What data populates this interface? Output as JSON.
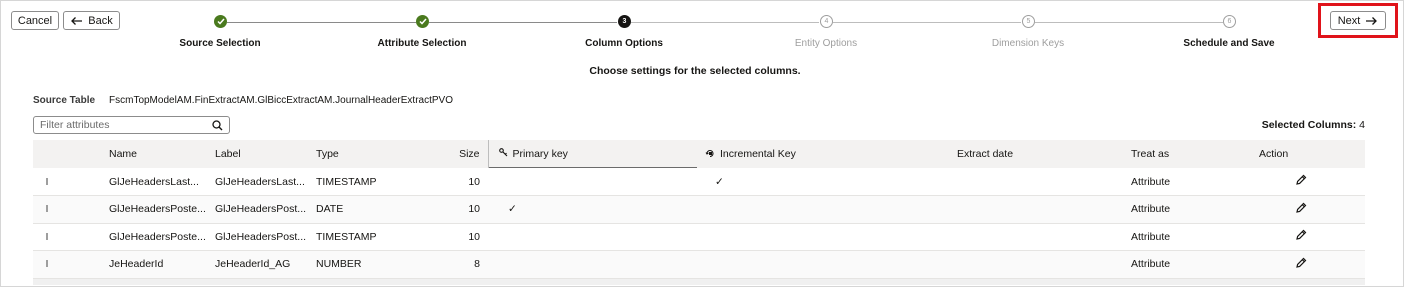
{
  "toolbar": {
    "cancel_label": "Cancel",
    "back_label": "Back",
    "next_label": "Next"
  },
  "train": {
    "steps": [
      {
        "number": "1",
        "label": "Source Selection",
        "state": "done"
      },
      {
        "number": "2",
        "label": "Attribute Selection",
        "state": "done"
      },
      {
        "number": "3",
        "label": "Column Options",
        "state": "current"
      },
      {
        "number": "4",
        "label": "Entity Options",
        "state": "future"
      },
      {
        "number": "5",
        "label": "Dimension Keys",
        "state": "future"
      },
      {
        "number": "6",
        "label": "Schedule and Save",
        "state": "future"
      }
    ]
  },
  "page": {
    "subtitle": "Choose settings for the selected columns.",
    "source_table_label": "Source Table",
    "source_table_value": "FscmTopModelAM.FinExtractAM.GlBiccExtractAM.JournalHeaderExtractPVO"
  },
  "filter": {
    "placeholder": "Filter attributes"
  },
  "selected": {
    "label": "Selected Columns:",
    "count": "4"
  },
  "table": {
    "headers": {
      "name": "Name",
      "label": "Label",
      "type": "Type",
      "size": "Size",
      "primary_key": "Primary key",
      "incremental_key": "Incremental Key",
      "extract_date": "Extract date",
      "treat_as": "Treat as",
      "action": "Action"
    },
    "rows": [
      {
        "name": "GlJeHeadersLast...",
        "label": "GlJeHeadersLast...",
        "type": "TIMESTAMP",
        "size": "10",
        "primary_key": "",
        "incremental_key": "✓",
        "extract_date": "",
        "treat_as": "Attribute"
      },
      {
        "name": "GlJeHeadersPoste...",
        "label": "GlJeHeadersPost...",
        "type": "DATE",
        "size": "10",
        "primary_key": "✓",
        "incremental_key": "",
        "extract_date": "",
        "treat_as": "Attribute"
      },
      {
        "name": "GlJeHeadersPoste...",
        "label": "GlJeHeadersPost...",
        "type": "TIMESTAMP",
        "size": "10",
        "primary_key": "",
        "incremental_key": "",
        "extract_date": "",
        "treat_as": "Attribute"
      },
      {
        "name": "JeHeaderId",
        "label": "JeHeaderId_AG",
        "type": "NUMBER",
        "size": "8",
        "primary_key": "",
        "incremental_key": "",
        "extract_date": "",
        "treat_as": "Attribute"
      }
    ]
  },
  "colors": {
    "done_step": "#4a7a1e",
    "current_step": "#161513",
    "highlight": "#e0131a"
  }
}
